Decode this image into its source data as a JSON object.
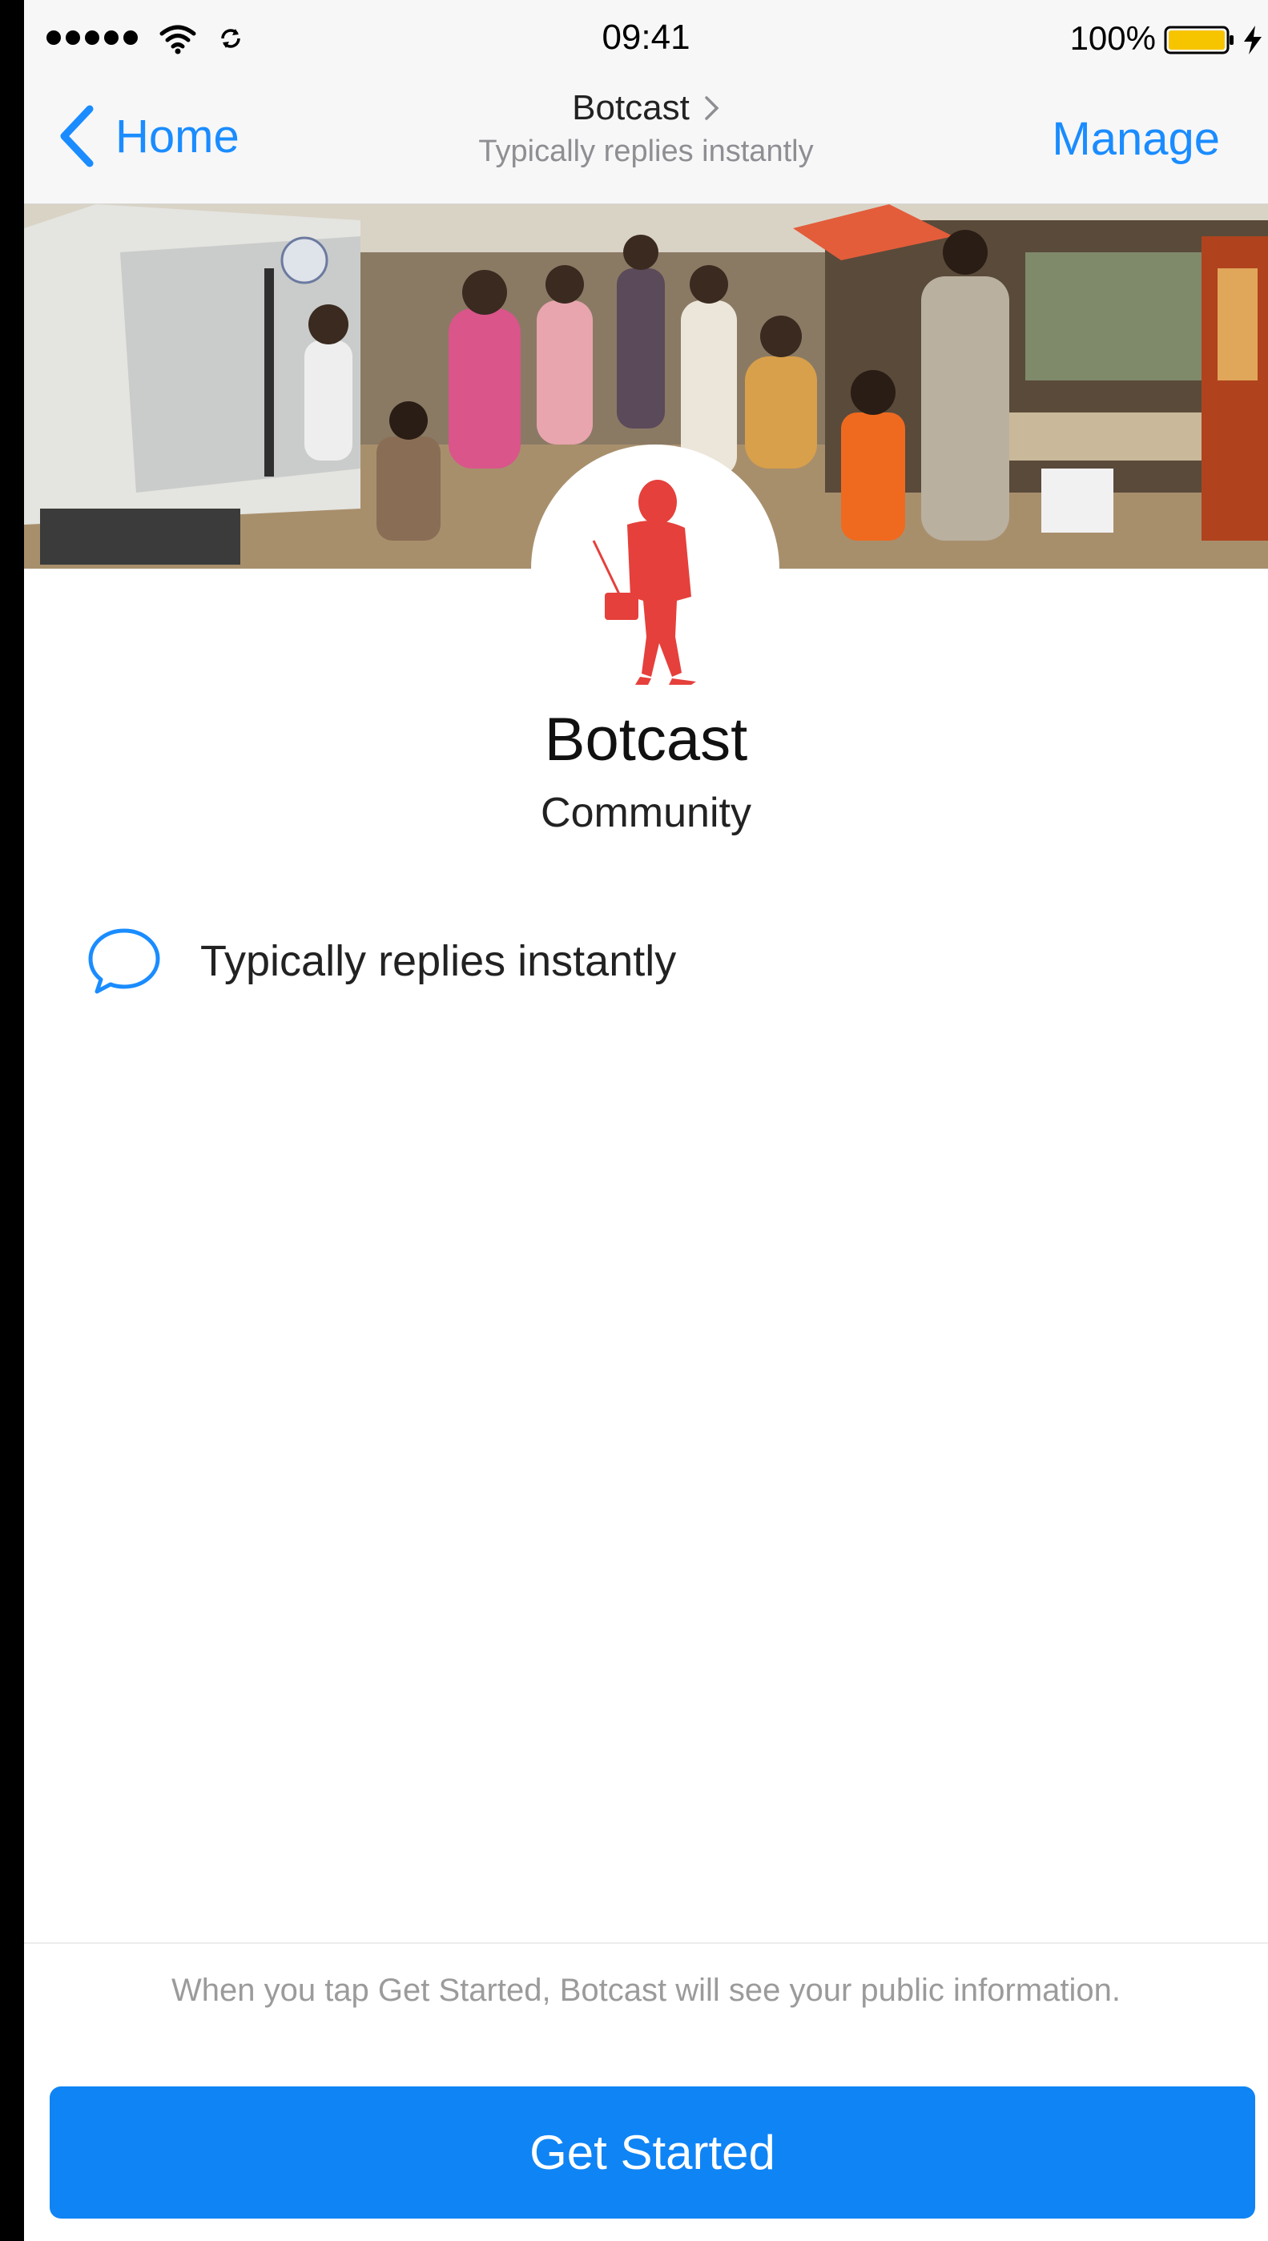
{
  "status_bar": {
    "time": "09:41",
    "battery_percent": "100%",
    "battery_color": "#f7c400"
  },
  "nav": {
    "back_label": "Home",
    "title": "Botcast",
    "subtitle": "Typically replies instantly",
    "manage_label": "Manage",
    "accent_color": "#1a8cff"
  },
  "profile": {
    "name": "Botcast",
    "category": "Community",
    "avatar_color": "#e5403b",
    "response_text": "Typically replies instantly"
  },
  "footer": {
    "privacy_note": "When you tap Get Started, Botcast will see your public information.",
    "button_label": "Get Started",
    "button_color": "#0f84f5"
  },
  "icons": [
    "signal-dots-icon",
    "wifi-icon",
    "sync-icon",
    "battery-icon",
    "bolt-icon",
    "back-chevron-icon",
    "chevron-right-icon",
    "chat-bubble-icon"
  ]
}
